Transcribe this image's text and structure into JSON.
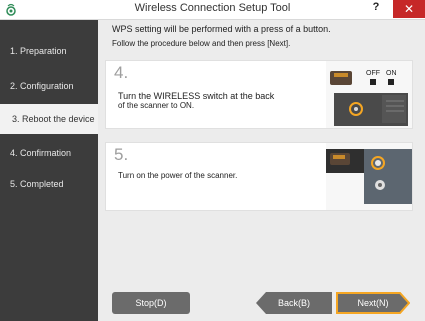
{
  "window": {
    "title": "Wireless Connection Setup Tool",
    "help_label": "?",
    "close_label": "✕"
  },
  "sidebar": {
    "steps": [
      {
        "label": "1. Preparation"
      },
      {
        "label": "2. Configuration"
      },
      {
        "label": "3. Reboot the device"
      },
      {
        "label": "4. Confirmation"
      },
      {
        "label": "5. Completed"
      }
    ],
    "active_index": 2
  },
  "main": {
    "instruction_line1": "WPS setting will be performed with a press of a button.",
    "instruction_line2": "Follow the procedure below and then press [Next].",
    "cards": [
      {
        "number": "4.",
        "text_line1": "Turn the WIRELESS switch at the back",
        "text_line2": "of the scanner to ON.",
        "illus_off": "OFF",
        "illus_on": "ON"
      },
      {
        "number": "5.",
        "text_line1": "Turn on the power of the scanner."
      }
    ]
  },
  "buttons": {
    "stop": "Stop(D)",
    "back": "Back(B)",
    "next": "Next(N)"
  },
  "colors": {
    "sidebar_bg": "#3c3c3c",
    "accent_orange": "#f5a623",
    "close_red": "#c62828",
    "button_gray": "#6b6b6b"
  }
}
